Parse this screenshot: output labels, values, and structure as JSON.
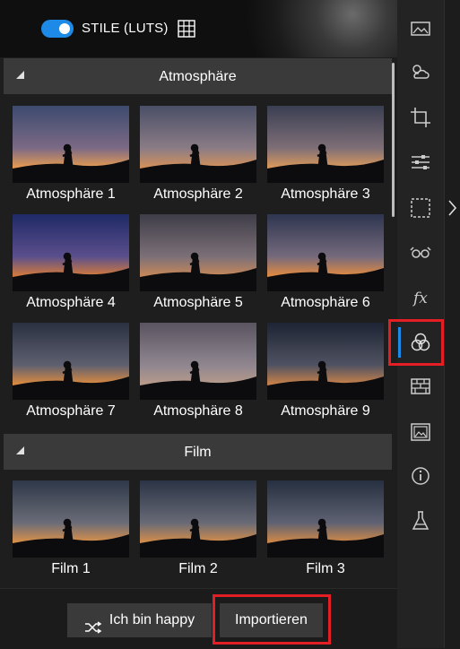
{
  "header": {
    "title": "STILE (LUTS)",
    "toggle_on": true
  },
  "sections": [
    {
      "title": "Atmosphäre",
      "items": [
        "Atmosphäre 1",
        "Atmosphäre 2",
        "Atmosphäre 3",
        "Atmosphäre 4",
        "Atmosphäre 5",
        "Atmosphäre 6",
        "Atmosphäre 7",
        "Atmosphäre 8",
        "Atmosphäre 9"
      ]
    },
    {
      "title": "Film",
      "items": [
        "Film 1",
        "Film 2",
        "Film 3"
      ]
    }
  ],
  "buttons": {
    "happy": "Ich bin happy",
    "import": "Importieren"
  },
  "rail": {
    "icons": [
      "landscape-icon",
      "weather-icon",
      "crop-icon",
      "sliders-icon",
      "selection-icon",
      "glasses-icon",
      "fx-icon",
      "styles-icon",
      "texture-icon",
      "image-icon",
      "info-icon",
      "flask-icon"
    ],
    "active": "styles-icon"
  },
  "colors": {
    "accent": "#1c8ae6",
    "highlight": "#e31e24"
  }
}
